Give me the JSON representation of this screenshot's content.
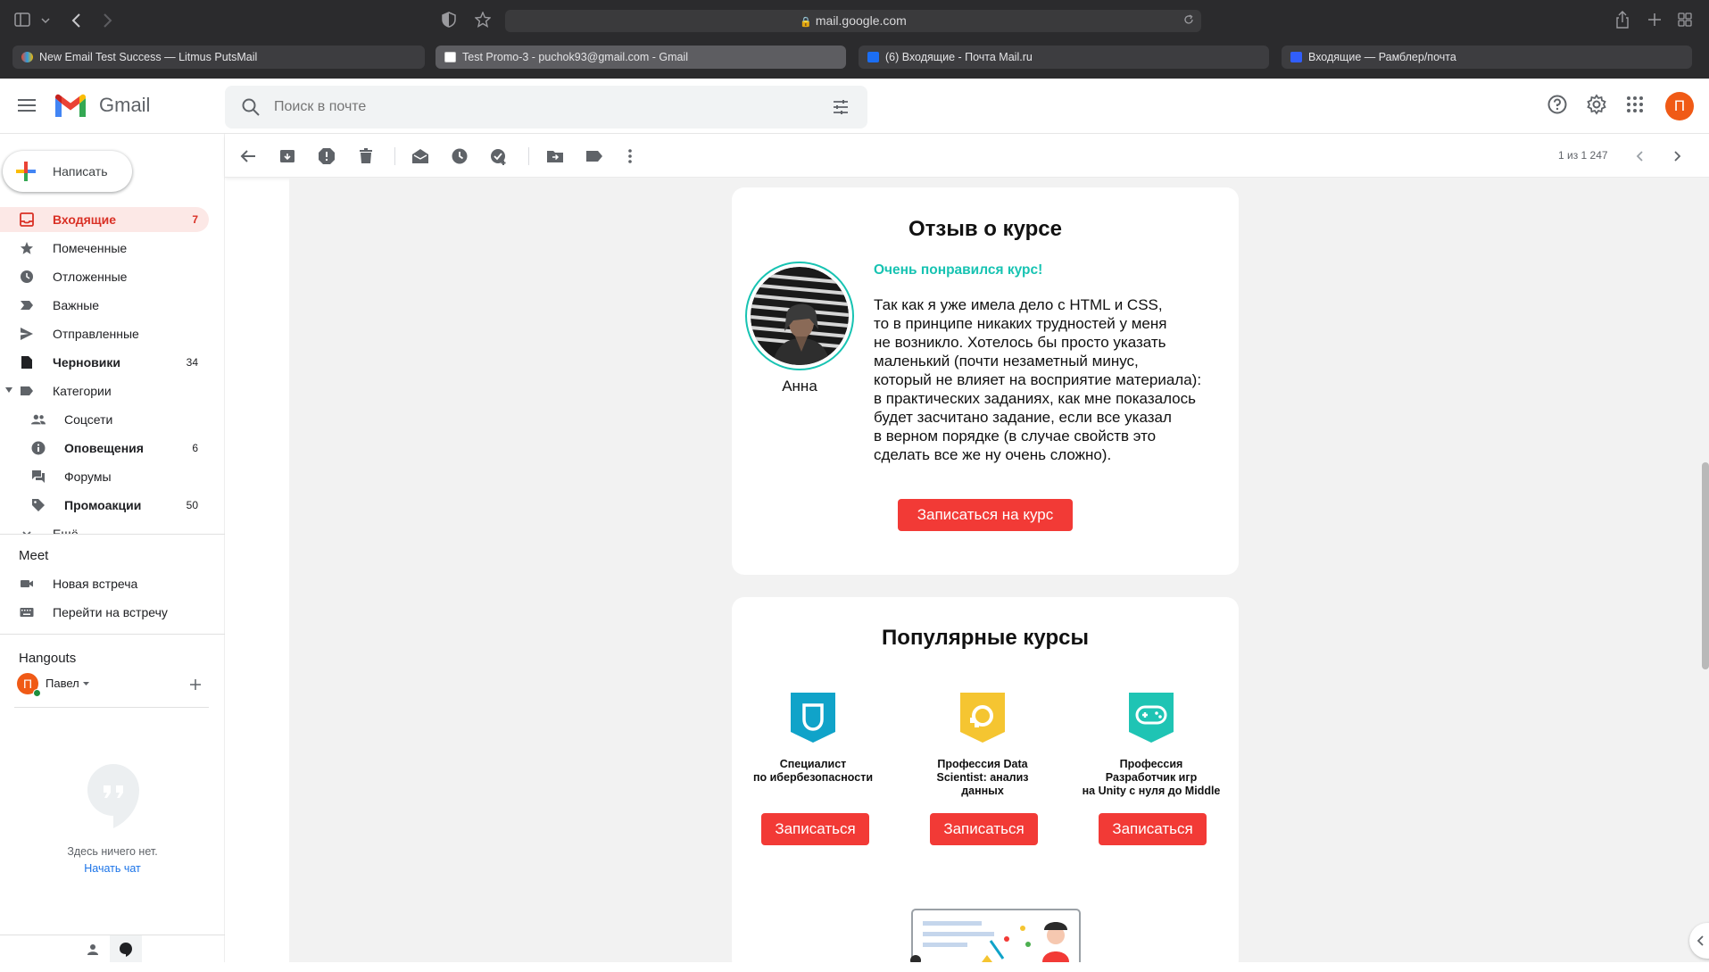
{
  "browser": {
    "url": "mail.google.com",
    "tabs": [
      {
        "label": "New Email Test Success — Litmus PutsMail"
      },
      {
        "label": "Test Promo-3 - puchok93@gmail.com - Gmail"
      },
      {
        "label": "(6) Входящие - Почта Mail.ru"
      },
      {
        "label": "Входящие — Рамблер/почта"
      }
    ]
  },
  "gmail": {
    "logo_text": "Gmail",
    "search_placeholder": "Поиск в почте",
    "avatar_letter": "П"
  },
  "sidebar": {
    "compose_label": "Написать",
    "items": [
      {
        "label": "Входящие",
        "count": "7"
      },
      {
        "label": "Помеченные",
        "count": ""
      },
      {
        "label": "Отложенные",
        "count": ""
      },
      {
        "label": "Важные",
        "count": ""
      },
      {
        "label": "Отправленные",
        "count": ""
      },
      {
        "label": "Черновики",
        "count": "34"
      },
      {
        "label": "Категории",
        "count": ""
      },
      {
        "label": "Соцсети",
        "count": ""
      },
      {
        "label": "Оповещения",
        "count": "6"
      },
      {
        "label": "Форумы",
        "count": ""
      },
      {
        "label": "Промоакции",
        "count": "50"
      },
      {
        "label": "Ещё",
        "count": ""
      }
    ],
    "meet": {
      "title": "Meet",
      "new_meeting": "Новая встреча",
      "join_meeting": "Перейти на встречу"
    },
    "hangouts": {
      "title": "Hangouts",
      "user_letter": "П",
      "user_name": "Павел",
      "empty_text": "Здесь ничего нет.",
      "start_chat": "Начать чат"
    }
  },
  "toolbar": {
    "pager": "1 из 1 247"
  },
  "email": {
    "review": {
      "heading": "Отзыв о курсе",
      "reviewer_name": "Анна",
      "highlight": "Очень понравился курс!",
      "text_lines": [
        "Так как я уже имела дело с HTML и CSS,",
        "то в принципе никаких трудностей у меня",
        "не возникло. Хотелось бы просто указать",
        "маленький (почти незаметный минус,",
        "который не влияет на восприятие материала):",
        "в практических заданиях, как мне показалось",
        "будет засчитано задание, если все указал",
        "в верном порядке (в случае свойств это",
        "сделать все же ну очень сложно)."
      ],
      "button": "Записаться на курс"
    },
    "popular": {
      "heading": "Популярные курсы",
      "courses": [
        {
          "title_lines": [
            "Специалист",
            "по ибербезопасности"
          ],
          "button": "Записаться",
          "badge_color": "#10a3c9"
        },
        {
          "title_lines": [
            "Профессия Data",
            "Scientist: анализ",
            "данных"
          ],
          "button": "Записаться",
          "badge_color": "#f5c531"
        },
        {
          "title_lines": [
            "Профессия",
            "Разработчик игр",
            "на Unity с нуля до Middle"
          ],
          "button": "Записаться",
          "badge_color": "#1fc4b4"
        }
      ]
    }
  },
  "colors": {
    "accent_red": "#f23a36",
    "highlight_teal": "#17c3b2",
    "gmail_red": "#d93025",
    "avatar_orange": "#f05a16"
  }
}
